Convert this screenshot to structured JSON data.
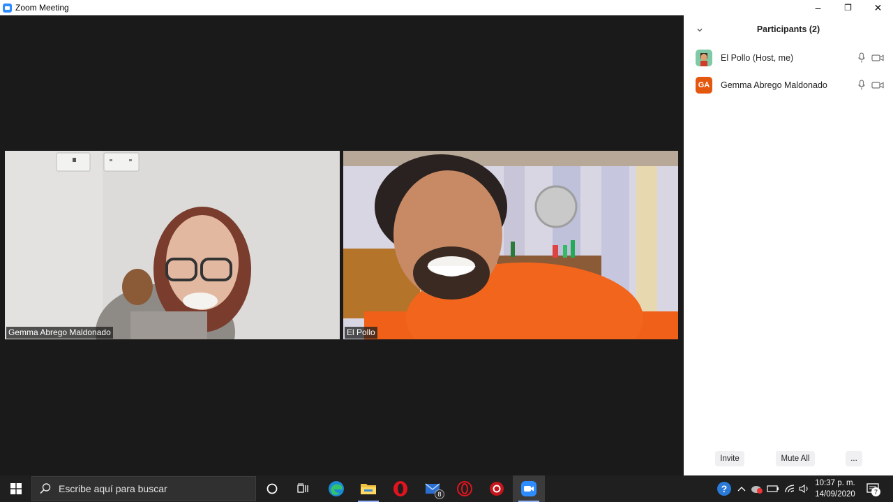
{
  "window": {
    "title": "Zoom Meeting",
    "controls": {
      "minimize": "–",
      "restore": "❐",
      "close": "✕"
    }
  },
  "meeting": {
    "tiles": [
      {
        "name": "Gemma Abrego Maldonado",
        "background": "#d8d7d5"
      },
      {
        "name": "El Pollo",
        "background": "#e9642a"
      }
    ]
  },
  "participants_panel": {
    "title": "Participants (2)",
    "participants": [
      {
        "name": "El Pollo (Host, me)",
        "avatar": "character-avatar-icon",
        "mic": "mic-icon",
        "camera": "video-camera-icon"
      },
      {
        "name": "Gemma Abrego Maldonado",
        "initials": "GA",
        "avatar_color": "#e4570f",
        "mic": "mic-icon",
        "camera": "video-camera-icon"
      }
    ],
    "buttons": {
      "invite": "Invite",
      "mute_all": "Mute All",
      "more": "..."
    }
  },
  "taskbar": {
    "search_placeholder": "Escribe aquí para buscar",
    "mail_badge": "8",
    "clock": {
      "time": "10:37 p. m.",
      "date": "14/09/2020"
    },
    "notifications_count": "7"
  },
  "colors": {
    "zoom_blue": "#2d8cff",
    "meeting_bg": "#1a1a1a",
    "taskbar_bg": "#1f1f1f"
  }
}
